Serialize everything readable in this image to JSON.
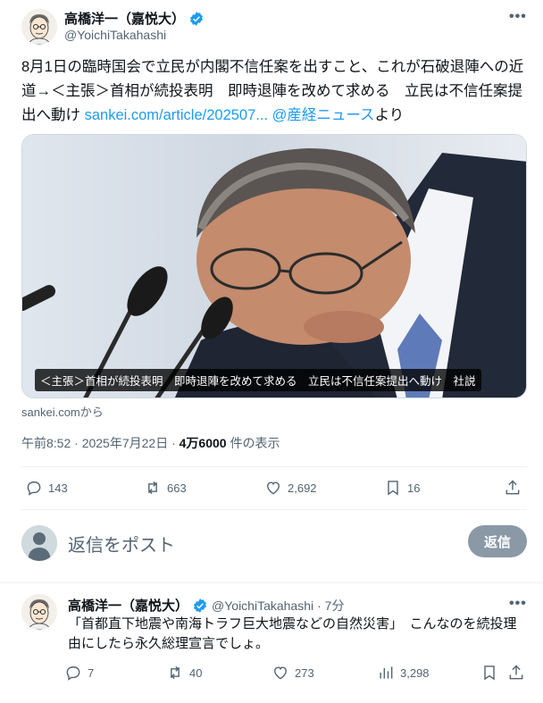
{
  "main_post": {
    "author_name": "高橋洋一（嘉悦大）",
    "author_handle": "@YoichiTakahashi",
    "more_label": "•••",
    "text_before_link": "8月1日の臨時国会で立民が内閣不信任案を出すこと、これが石破退陣への近道→＜主張＞首相が続投表明　即時退陣を改めて求める　立民は不信任案提出へ動け ",
    "link_text": "sankei.com/article/202507...",
    "mention_text": " @産経ニュース",
    "text_after_link": "より",
    "media_caption": "＜主張＞首相が続投表明　即時退陣を改めて求める　立民は不信任案提出へ動け　社説",
    "source_text": "sankei.comから",
    "timestamp": "午前8:52 · 2025年7月22日 · ",
    "views_count": "4万6000",
    "views_label": " 件の表示",
    "replies": "143",
    "reposts": "663",
    "likes": "2,692",
    "bookmarks": "16"
  },
  "reply_composer": {
    "placeholder": "返信をポスト",
    "button_label": "返信"
  },
  "reply_post": {
    "author_name": "高橋洋一（嘉悦大）",
    "author_handle": "@YoichiTakahashi",
    "time": "· 7分",
    "text": "「首都直下地震や南海トラフ巨大地震などの自然災害」　こんなのを続投理由にしたら永久総理宣言でしょ。",
    "replies": "7",
    "reposts": "40",
    "likes": "273",
    "views": "3,298"
  },
  "colors": {
    "accent": "#1d9bf0",
    "secondary_text": "#536471",
    "primary_text": "#0f1419",
    "reply_button_bg": "#8b98a5"
  },
  "icons": [
    "verified-badge-icon",
    "more-icon",
    "reply-icon",
    "repost-icon",
    "like-icon",
    "bookmark-icon",
    "share-icon",
    "views-icon"
  ]
}
